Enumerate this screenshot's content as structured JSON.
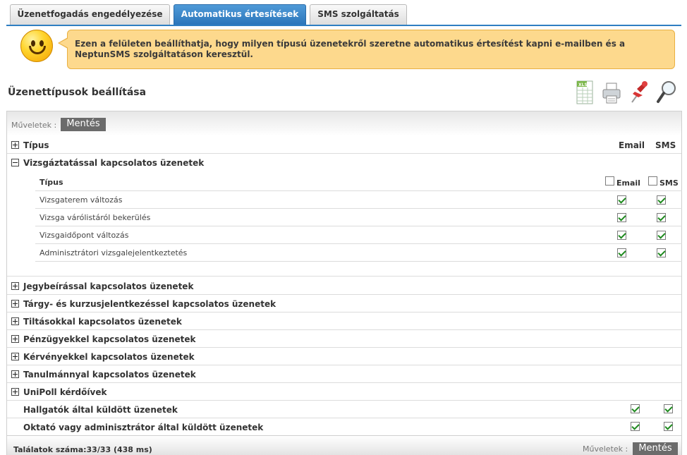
{
  "tabs": [
    {
      "label": "Üzenetfogadás engedélyezése",
      "active": false
    },
    {
      "label": "Automatikus értesítések",
      "active": true
    },
    {
      "label": "SMS szolgáltatás",
      "active": false
    }
  ],
  "info": {
    "text": "Ezen a felületen beállíthatja, hogy milyen típusú üzenetekről szeretne automatikus értesítést kapni e-mailben és a NeptunSMS szolgáltatáson keresztül."
  },
  "page_title": "Üzenettípusok beállítása",
  "toolbar_icons": [
    "xls-export-icon",
    "print-icon",
    "pin-icon",
    "search-icon"
  ],
  "toolbar": {
    "ops_label": "Műveletek :",
    "save_label": "Mentés"
  },
  "table": {
    "header": {
      "label": "Típus",
      "email": "Email",
      "sms": "SMS"
    },
    "expanded_group": {
      "label": "Vizsgáztatással kapcsolatos üzenetek",
      "sub_header": {
        "label": "Típus",
        "email": "Email",
        "sms": "SMS",
        "email_all": false,
        "sms_all": false
      },
      "items": [
        {
          "label": "Vizsgaterem változás",
          "email": true,
          "sms": true
        },
        {
          "label": "Vizsga várólistáról bekerülés",
          "email": true,
          "sms": true
        },
        {
          "label": "Vizsgaidőpont változás",
          "email": true,
          "sms": true
        },
        {
          "label": "Adminisztrátori vizsgalejelentkeztetés",
          "email": true,
          "sms": true
        }
      ]
    },
    "collapsed_groups": [
      {
        "label": "Jegybeírással kapcsolatos üzenetek"
      },
      {
        "label": "Tárgy- és kurzusjelentkezéssel kapcsolatos üzenetek"
      },
      {
        "label": "Tiltásokkal kapcsolatos üzenetek"
      },
      {
        "label": "Pénzügyekkel kapcsolatos üzenetek"
      },
      {
        "label": "Kérvényekkel kapcsolatos üzenetek"
      },
      {
        "label": "Tanulmánnyal kapcsolatos üzenetek"
      },
      {
        "label": "UniPoll kérdőívek"
      }
    ],
    "leaf_rows": [
      {
        "label": "Hallgatók által küldött üzenetek",
        "email": true,
        "sms": true
      },
      {
        "label": "Oktató vagy adminisztrátor által küldött üzenetek",
        "email": true,
        "sms": true
      }
    ]
  },
  "footer": {
    "count_label": "Találatok száma:33/33 (438 ms)",
    "ops_label": "Műveletek :",
    "save_label": "Mentés"
  }
}
